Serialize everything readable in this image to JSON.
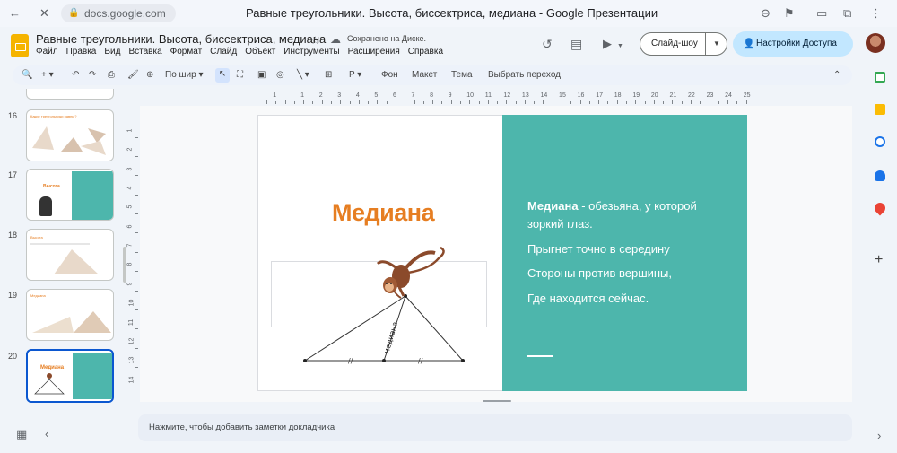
{
  "browser": {
    "url": "docs.google.com",
    "title": "Равные треугольники. Высота, биссектриса, медиана - Google Презентации"
  },
  "doc": {
    "title": "Равные треугольники. Высота, биссектриса, медиана",
    "save_status": "Сохранено на Диске.",
    "menu": [
      "Файл",
      "Правка",
      "Вид",
      "Вставка",
      "Формат",
      "Слайд",
      "Объект",
      "Инструменты",
      "Расширения",
      "Справка"
    ],
    "slideshow_label": "Слайд-шоу",
    "share_label": "Настройки Доступа"
  },
  "toolbar": {
    "zoom_label": "По шир",
    "background_label": "Фон",
    "layout_label": "Макет",
    "theme_label": "Тема",
    "transition_label": "Выбрать переход"
  },
  "filmstrip": {
    "slides": [
      {
        "num": "16",
        "title": "Какие треугольники равны?"
      },
      {
        "num": "17",
        "title": "Высота"
      },
      {
        "num": "18",
        "title": "Высота"
      },
      {
        "num": "19",
        "title": "Медиана"
      },
      {
        "num": "20",
        "title": "Медиана",
        "selected": true
      }
    ]
  },
  "ruler": {
    "h_numbers": [
      "1",
      "1",
      "2",
      "3",
      "4",
      "5",
      "6",
      "7",
      "8",
      "9",
      "10",
      "11",
      "12",
      "13",
      "14",
      "15",
      "16",
      "17",
      "18",
      "19",
      "20",
      "21",
      "22",
      "23",
      "24",
      "25"
    ],
    "v_numbers": [
      "1",
      "2",
      "3",
      "4",
      "5",
      "6",
      "7",
      "8",
      "9",
      "10",
      "11",
      "12",
      "13",
      "14"
    ]
  },
  "slide": {
    "heading": "Медиана",
    "median_label": "медиана",
    "tick_mark": "//",
    "text_bold": "Медиана",
    "text_line1": " - обезьяна, у которой",
    "text_line2": "зоркий глаз.",
    "text_line3": "Прыгнет точно в середину",
    "text_line4": "Стороны против вершины,",
    "text_line5": "Где находится сейчас.",
    "accent_color": "#4db6ac",
    "heading_color": "#e67e22"
  },
  "notes_placeholder": "Нажмите, чтобы добавить заметки докладчика"
}
